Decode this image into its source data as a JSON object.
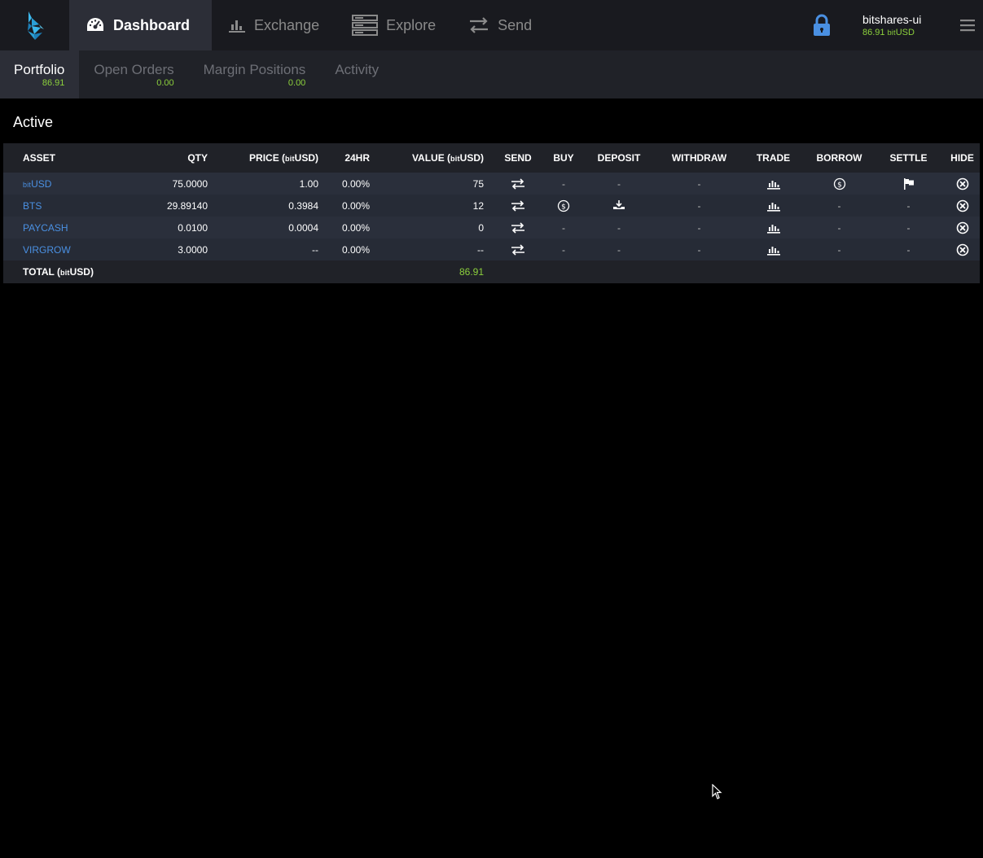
{
  "header": {
    "nav": [
      {
        "label": "Dashboard",
        "icon": "dashboard-icon",
        "active": true
      },
      {
        "label": "Exchange",
        "icon": "chart-icon",
        "active": false
      },
      {
        "label": "Explore",
        "icon": "server-icon",
        "active": false
      },
      {
        "label": "Send",
        "icon": "transfer-icon",
        "active": false
      }
    ],
    "account": {
      "name": "bitshares-ui",
      "balance": "86.91",
      "balance_unit_prefix": "bit",
      "balance_unit": "USD"
    }
  },
  "subtabs": [
    {
      "label": "Portfolio",
      "value": "86.91",
      "active": true
    },
    {
      "label": "Open Orders",
      "value": "0.00",
      "active": false
    },
    {
      "label": "Margin Positions",
      "value": "0.00",
      "active": false
    },
    {
      "label": "Activity",
      "value": "",
      "active": false
    }
  ],
  "section_title": "Active",
  "table": {
    "headers": {
      "asset": "ASSET",
      "qty": "QTY",
      "price_prefix": "PRICE (",
      "price_unit_prefix": "bit",
      "price_suffix": "USD)",
      "change": "24HR",
      "value_prefix": "VALUE (",
      "value_unit_prefix": "bit",
      "value_suffix": "USD)",
      "send": "SEND",
      "buy": "BUY",
      "deposit": "DEPOSIT",
      "withdraw": "WITHDRAW",
      "trade": "TRADE",
      "borrow": "BORROW",
      "settle": "SETTLE",
      "hide": "HIDE"
    },
    "rows": [
      {
        "asset_prefix": "bit",
        "asset": "USD",
        "qty": "75.0000",
        "price": "1.00",
        "change": "0.00%",
        "value": "75",
        "buy": "-",
        "deposit": "-",
        "withdraw": "-",
        "borrow": "borrow",
        "settle": "settle"
      },
      {
        "asset_prefix": "",
        "asset": "BTS",
        "qty": "29.89140",
        "price": "0.3984",
        "change": "0.00%",
        "value": "12",
        "buy": "buy",
        "deposit": "deposit",
        "withdraw": "-",
        "borrow": "-",
        "settle": "-"
      },
      {
        "asset_prefix": "",
        "asset": "PAYCASH",
        "qty": "0.0100",
        "price": "0.0004",
        "change": "0.00%",
        "value": "0",
        "buy": "-",
        "deposit": "-",
        "withdraw": "-",
        "borrow": "-",
        "settle": "-"
      },
      {
        "asset_prefix": "",
        "asset": "VIRGROW",
        "qty": "3.0000",
        "price": "--",
        "change": "0.00%",
        "value": "--",
        "buy": "-",
        "deposit": "-",
        "withdraw": "-",
        "borrow": "-",
        "settle": "-"
      }
    ],
    "total": {
      "label_prefix": "TOTAL (",
      "label_unit_prefix": "bit",
      "label_suffix": "USD)",
      "value": "86.91"
    }
  },
  "colors": {
    "accent_green": "#8cd03c",
    "link_blue": "#4a90e2",
    "logo_blue": "#3db8ec"
  }
}
